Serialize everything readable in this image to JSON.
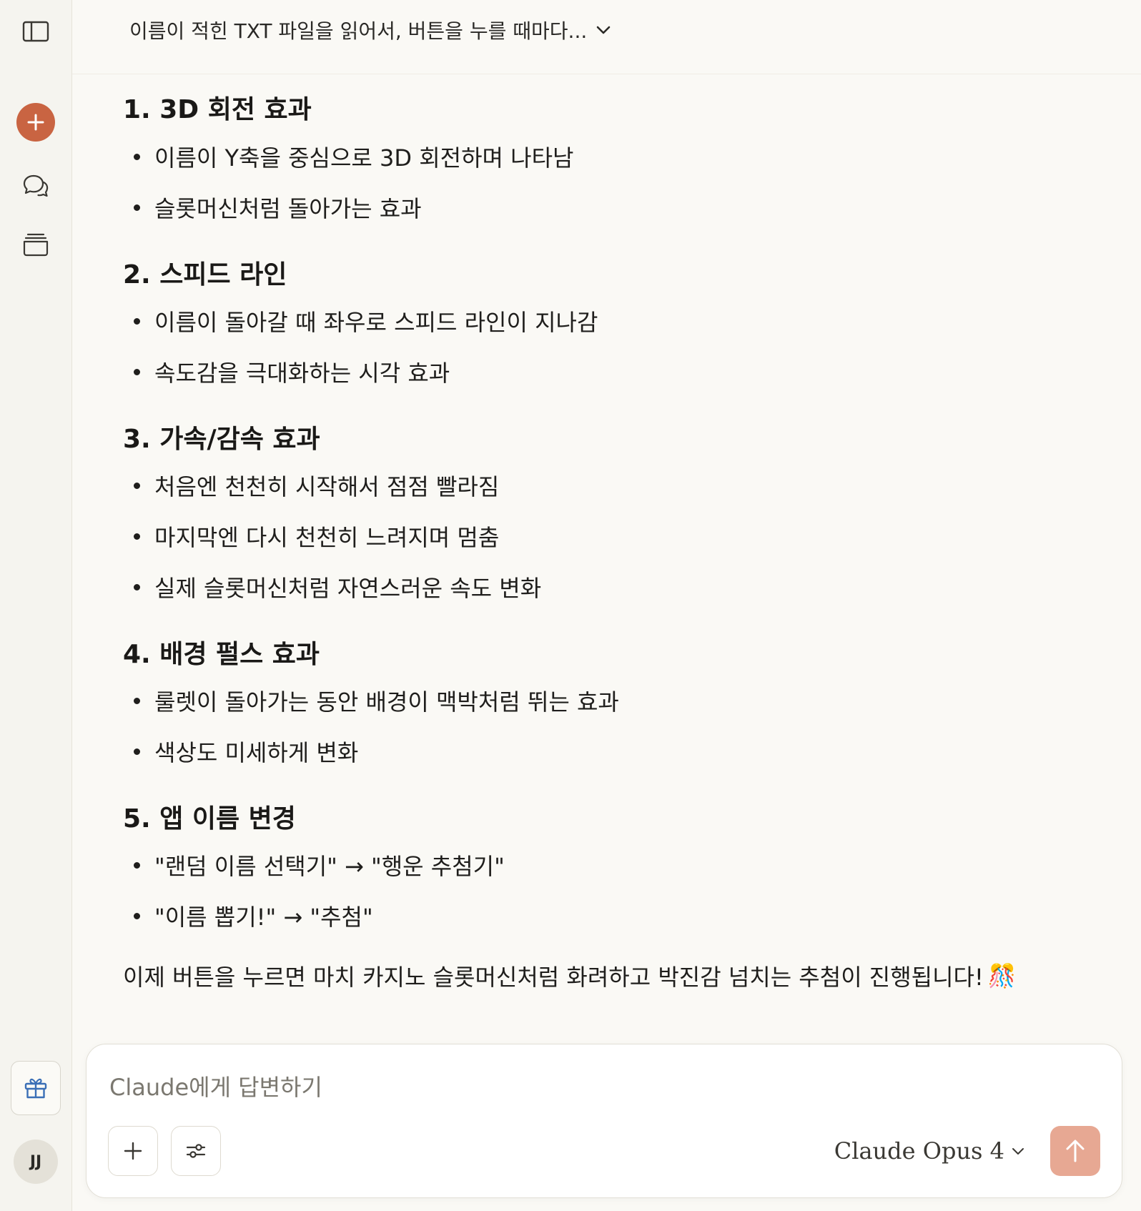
{
  "header": {
    "title": "이름이 적힌 TXT 파일을 읽어서, 버튼을 누를 때마다..."
  },
  "sidebar": {
    "avatar_initials": "JJ"
  },
  "message": {
    "sections": [
      {
        "title": "1. 3D 회전 효과",
        "bullets": [
          "이름이 Y축을 중심으로 3D 회전하며 나타남",
          "슬롯머신처럼 돌아가는 효과"
        ]
      },
      {
        "title": "2. 스피드 라인",
        "bullets": [
          "이름이 돌아갈 때 좌우로 스피드 라인이 지나감",
          "속도감을 극대화하는 시각 효과"
        ]
      },
      {
        "title": "3. 가속/감속 효과",
        "bullets": [
          "처음엔 천천히 시작해서 점점 빨라짐",
          "마지막엔 다시 천천히 느려지며 멈춤",
          "실제 슬롯머신처럼 자연스러운 속도 변화"
        ]
      },
      {
        "title": "4. 배경 펄스 효과",
        "bullets": [
          "룰렛이 돌아가는 동안 배경이 맥박처럼 뛰는 효과",
          "색상도 미세하게 변화"
        ]
      },
      {
        "title": "5. 앱 이름 변경",
        "bullets": [
          "\"랜덤 이름 선택기\" → \"행운 추첨기\"",
          "\"이름 뽑기!\" → \"추첨\""
        ]
      }
    ],
    "closing": "이제 버튼을 누르면 마치 카지노 슬롯머신처럼 화려하고 박진감 넘치는 추첨이 진행됩니다!",
    "closing_emoji": "🎊"
  },
  "composer": {
    "placeholder": "Claude에게 답변하기",
    "model": "Claude Opus 4"
  },
  "colors": {
    "accent": "#c96442",
    "send_disabled": "#e7a893",
    "background": "#faf9f5",
    "sidebar": "#f5f4ef"
  },
  "icons": {
    "sidebar_toggle": "sidebar-toggle-icon",
    "new_chat": "plus-icon",
    "chats": "chat-bubbles-icon",
    "projects": "archive-icon",
    "gift": "gift-icon",
    "attach": "plus-icon",
    "tools": "sliders-icon",
    "chevron": "chevron-down-icon",
    "send": "arrow-up-icon"
  }
}
